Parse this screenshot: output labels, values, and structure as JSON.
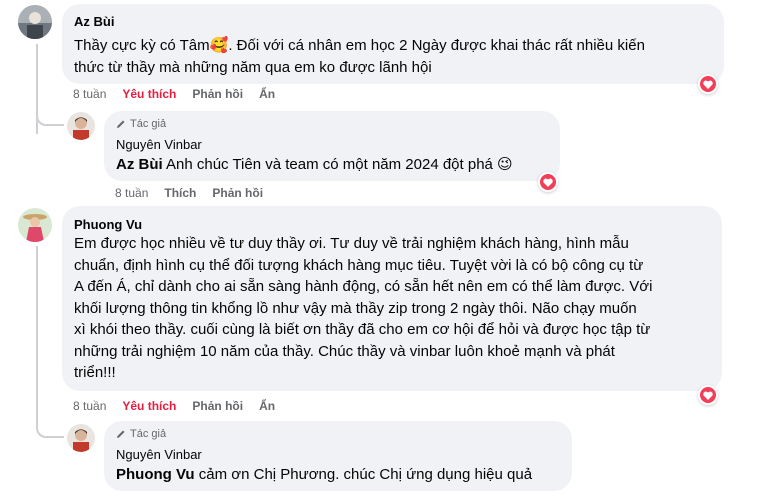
{
  "comments": [
    {
      "author": "Az Bùi",
      "text": "Thầy cực kỳ có Tâm🥰. Đối với cá nhân em học 2 Ngày được khai thác rất nhiều kiến thức từ thầy mà những năm qua em ko được lãnh hội",
      "line1": "Thầy cực kỳ có Tâm",
      "emoji": "🥰",
      "line1b": ". Đối với cá nhân em học 2 Ngày được khai thác rất nhiều kiến",
      "line2": "thức từ thầy mà những năm qua em ko được lãnh hội",
      "time": "8 tuần",
      "like_label": "Yêu thích",
      "reply_label": "Phản hồi",
      "hide_label": "Ẩn",
      "reaction": "heart-icon",
      "reply": {
        "author_tag": "Tác giả",
        "author": "Nguyên Vinbar",
        "mention": "Az Bùi",
        "text": " Anh chúc Tiên và team có một năm 2024 đột phá ",
        "emoji": "😉",
        "time": "8 tuần",
        "like_label": "Thích",
        "reply_label": "Phản hồi"
      }
    },
    {
      "author": "Phuong Vu",
      "lines": [
        "Em được học nhiều về tư duy thầy ơi. Tư duy về trải nghiệm khách hàng, hình mẫu",
        "chuẩn, định hình cụ thể đối tượng khách hàng mục tiêu. Tuyệt vời là có bộ công cụ từ",
        "A đến Á, chỉ dành cho ai sẵn sàng hành động, có sẵn hết nên em có thể làm được. Với",
        "khối lượng thông tin khổng lồ như vậy mà thầy zip trong 2 ngày thôi. Não chạy muốn",
        "xì khói theo thầy. cuối cùng là biết ơn thầy đã cho em cơ hội để hỏi và được học tập từ",
        "những trải nghiệm 10 năm của thầy. Chúc thầy và vinbar luôn khoẻ mạnh và phát",
        "triển!!!"
      ],
      "time": "8 tuần",
      "like_label": "Yêu thích",
      "reply_label": "Phản hồi",
      "hide_label": "Ẩn",
      "reply": {
        "author_tag": "Tác giả",
        "author": "Nguyên Vinbar",
        "mention": "Phuong Vu",
        "text": " cảm ơn Chị Phương. chúc Chị ứng dụng hiệu quả"
      }
    }
  ],
  "colors": {
    "bubble": "#f0f2f5",
    "liked": "#e41e3f",
    "heart": "#f33e58",
    "meta": "#65676b"
  }
}
